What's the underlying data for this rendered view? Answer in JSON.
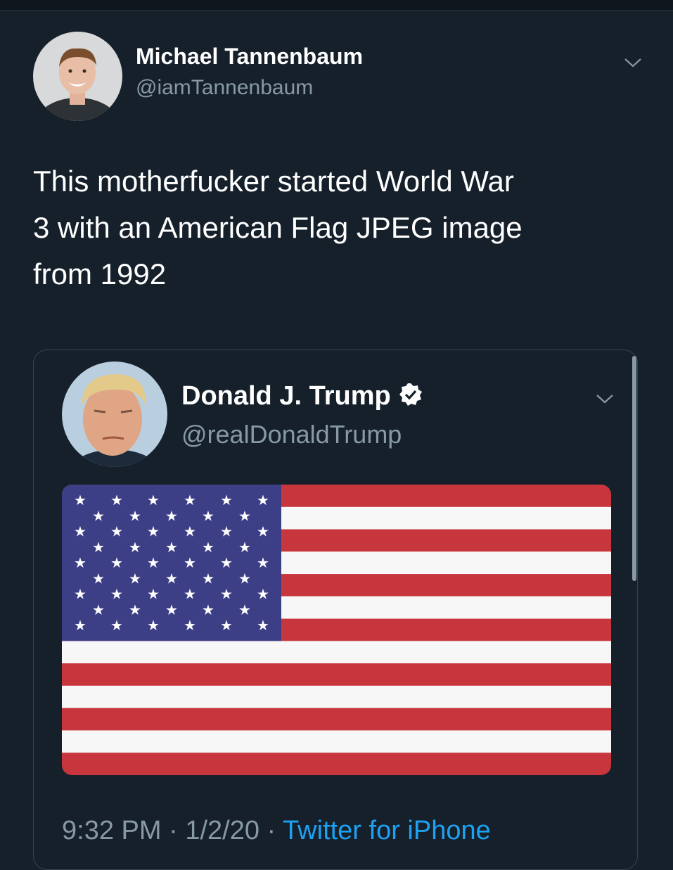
{
  "outer_tweet": {
    "author_name": "Michael Tannenbaum",
    "author_handle": "@iamTannenbaum",
    "text": "This motherfucker started World War\n3 with an American Flag JPEG image\nfrom 1992"
  },
  "quoted_tweet": {
    "author_name": "Donald J. Trump",
    "author_handle": "@realDonaldTrump",
    "verified": true,
    "media": "american-flag-image",
    "time": "9:32 PM",
    "separator": " · ",
    "date": "1/2/20",
    "client": "Twitter for iPhone"
  },
  "icons": {
    "chevron": "chevron-down-icon",
    "verified": "verified-badge-icon"
  },
  "colors": {
    "background": "#15202b",
    "secondary_text": "#8899a6",
    "link": "#1da1f2",
    "flag_red": "#c8363d",
    "flag_blue": "#3d3f86"
  }
}
